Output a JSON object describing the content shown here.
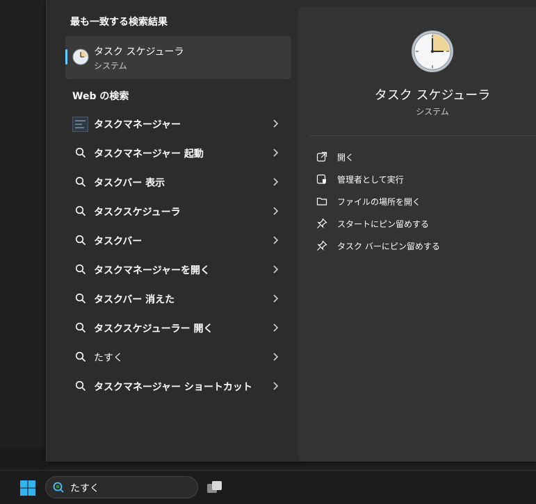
{
  "best_match": {
    "section_title": "最も一致する検索結果",
    "app_name": "タスク スケジューラ",
    "app_type": "システム"
  },
  "web": {
    "section_title": "Web の検索",
    "items": [
      {
        "label": "タスクマネージャー",
        "icon": "task-manager-app-icon"
      },
      {
        "label": "タスクマネージャー 起動",
        "icon": "search-icon"
      },
      {
        "label": "タスクバー 表示",
        "icon": "search-icon"
      },
      {
        "label": "タスクスケジューラ",
        "icon": "search-icon"
      },
      {
        "label": "タスクバー",
        "icon": "search-icon"
      },
      {
        "label": "タスクマネージャーを開く",
        "icon": "search-icon"
      },
      {
        "label": "タスクバー 消えた",
        "icon": "search-icon"
      },
      {
        "label": "タスクスケジューラー 開く",
        "icon": "search-icon"
      },
      {
        "label": "たすく",
        "icon": "search-icon"
      },
      {
        "label": "タスクマネージャー ショートカット",
        "icon": "search-icon"
      }
    ]
  },
  "detail": {
    "title": "タスク スケジューラ",
    "subtitle": "システム",
    "actions": [
      {
        "label": "開く",
        "icon": "open-icon"
      },
      {
        "label": "管理者として実行",
        "icon": "run-as-admin-icon"
      },
      {
        "label": "ファイルの場所を開く",
        "icon": "folder-icon"
      },
      {
        "label": "スタートにピン留めする",
        "icon": "pin-icon"
      },
      {
        "label": "タスク バーにピン留めする",
        "icon": "pin-icon"
      }
    ]
  },
  "taskbar": {
    "search_value": "たすく"
  },
  "colors": {
    "accent": "#60cdff",
    "panel": "#2c2c2c",
    "detail_panel": "#333333"
  }
}
